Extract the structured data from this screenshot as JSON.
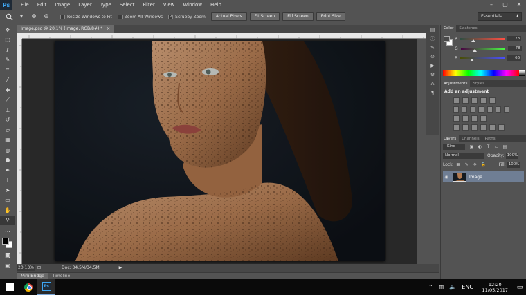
{
  "app": {
    "logo": "Ps"
  },
  "menu": [
    "File",
    "Edit",
    "Image",
    "Layer",
    "Type",
    "Select",
    "Filter",
    "View",
    "Window",
    "Help"
  ],
  "window_controls": {
    "minimize": "–",
    "restore": "▢",
    "close": "✕"
  },
  "options": {
    "tool_icon": "zoom-icon",
    "resize_windows": {
      "label": "Resize Windows to Fit",
      "checked": false
    },
    "zoom_all": {
      "label": "Zoom All Windows",
      "checked": false
    },
    "scrubby": {
      "label": "Scrubby Zoom",
      "checked": true
    },
    "buttons": [
      "Actual Pixels",
      "Fit Screen",
      "Fill Screen",
      "Print Size"
    ],
    "workspace": "Essentials"
  },
  "document": {
    "tab_title": "Image.psd @ 20.1% (Image, RGB/8#) *",
    "close": "×"
  },
  "status": {
    "zoom": "20.13%",
    "doc": "Doc: 34,5M/34,5M",
    "arrow": "▶"
  },
  "bottom_tabs": [
    "Mini Bridge",
    "Timeline"
  ],
  "color_panel": {
    "tabs": [
      "Color",
      "Swatches"
    ],
    "r": {
      "label": "R",
      "value": "73"
    },
    "g": {
      "label": "G",
      "value": "78"
    },
    "b": {
      "label": "B",
      "value": "66"
    }
  },
  "adjustments": {
    "tabs": [
      "Adjustments",
      "Styles"
    ],
    "title": "Add an adjustment"
  },
  "layers": {
    "tabs": [
      "Layers",
      "Channels",
      "Paths"
    ],
    "kind": "Kind",
    "blend": "Normal",
    "opacity_label": "Opacity:",
    "opacity": "100%",
    "lock_label": "Lock:",
    "fill_label": "Fill:",
    "fill": "100%",
    "items": [
      {
        "name": "Image"
      }
    ]
  },
  "taskbar": {
    "lang": "ENG",
    "time": "12:20",
    "date": "11/05/2017"
  }
}
